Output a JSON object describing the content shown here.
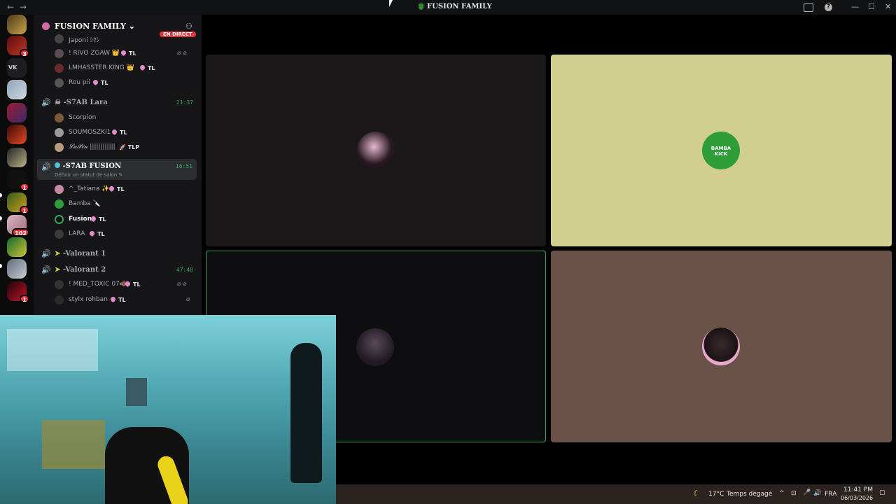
{
  "titlebar": {
    "back": "←",
    "forward": "→",
    "title": "FUSION FAMILY",
    "inbox_icon": "inbox-icon",
    "help_icon": "help-icon",
    "minimize": "—",
    "maximize": "☐",
    "close": "✕"
  },
  "servers": [
    {
      "badge": ""
    },
    {
      "badge": "3"
    },
    {
      "badge": ""
    },
    {
      "badge": ""
    },
    {
      "badge": ""
    },
    {
      "badge": ""
    },
    {
      "badge": ""
    },
    {
      "badge": "1"
    },
    {
      "badge": "1"
    },
    {
      "badge": "102"
    },
    {
      "badge": ""
    },
    {
      "badge": ""
    },
    {
      "badge": "1"
    }
  ],
  "sidebar": {
    "server_name": "FUSION FAMILY",
    "live_badge": "EN DIRECT",
    "rows_top": [
      {
        "name": "Japoni ｼｸｼ",
        "tag": ""
      },
      {
        "name": "! RIVO ZGAW 👑",
        "tag": "TL"
      },
      {
        "name": "LMHASSTER KING 👑",
        "tag": "TL"
      },
      {
        "name": "Rou pii",
        "tag": "TL"
      }
    ],
    "channel_lara": {
      "name": "-S7AB Lara",
      "time": "21:37"
    },
    "rows_lara": [
      {
        "name": "Scorpion",
        "tag": ""
      },
      {
        "name": "SOUMOSZKI1",
        "tag": "TL"
      },
      {
        "name": "𝓛𝓪𝓟𝓲𝓷 ||||||||||||",
        "tag": "TLP"
      }
    ],
    "channel_fusion": {
      "name": "-S7AB FUSION",
      "time": "16:51",
      "status": "Définir un statut de salon"
    },
    "rows_fusion": [
      {
        "name": "^_Tatiana ✨",
        "tag": "TL"
      },
      {
        "name": "Bamba 🔪",
        "tag": ""
      },
      {
        "name": "Fusion",
        "tag": "TL"
      },
      {
        "name": "LARA",
        "tag": "TL"
      }
    ],
    "channel_valo1": {
      "name": "-Valorant 1",
      "time": ""
    },
    "channel_valo2": {
      "name": "-Valorant 2",
      "time": "47:40"
    },
    "rows_valo2": [
      {
        "name": "! MED_TOXIC 07🐗",
        "tag": "TL"
      },
      {
        "name": "stylx rohban",
        "tag": "TL"
      }
    ]
  },
  "tiles": [
    {
      "bg": "#1b181a",
      "avatar": "dark-mask-avatar"
    },
    {
      "bg": "#d1cf8f",
      "avatar": "bamba-kick-avatar",
      "avatar_text": "BAMBA KICK"
    },
    {
      "bg": "#0e0e10",
      "avatar": "portrait-avatar",
      "speaking": true
    },
    {
      "bg": "#6b5248",
      "avatar": "flower-girl-avatar"
    }
  ],
  "taskbar": {
    "weather_icon": "moon-icon",
    "weather": "17°C",
    "weather_desc": "Temps dégagé",
    "lang": "FRA",
    "time": "11:41 PM",
    "date": "06/03/2026"
  },
  "colors": {
    "accent": "#3ba55c",
    "live": "#e3353b",
    "rail": "#0b0b0c",
    "sidebar": "#161618"
  }
}
